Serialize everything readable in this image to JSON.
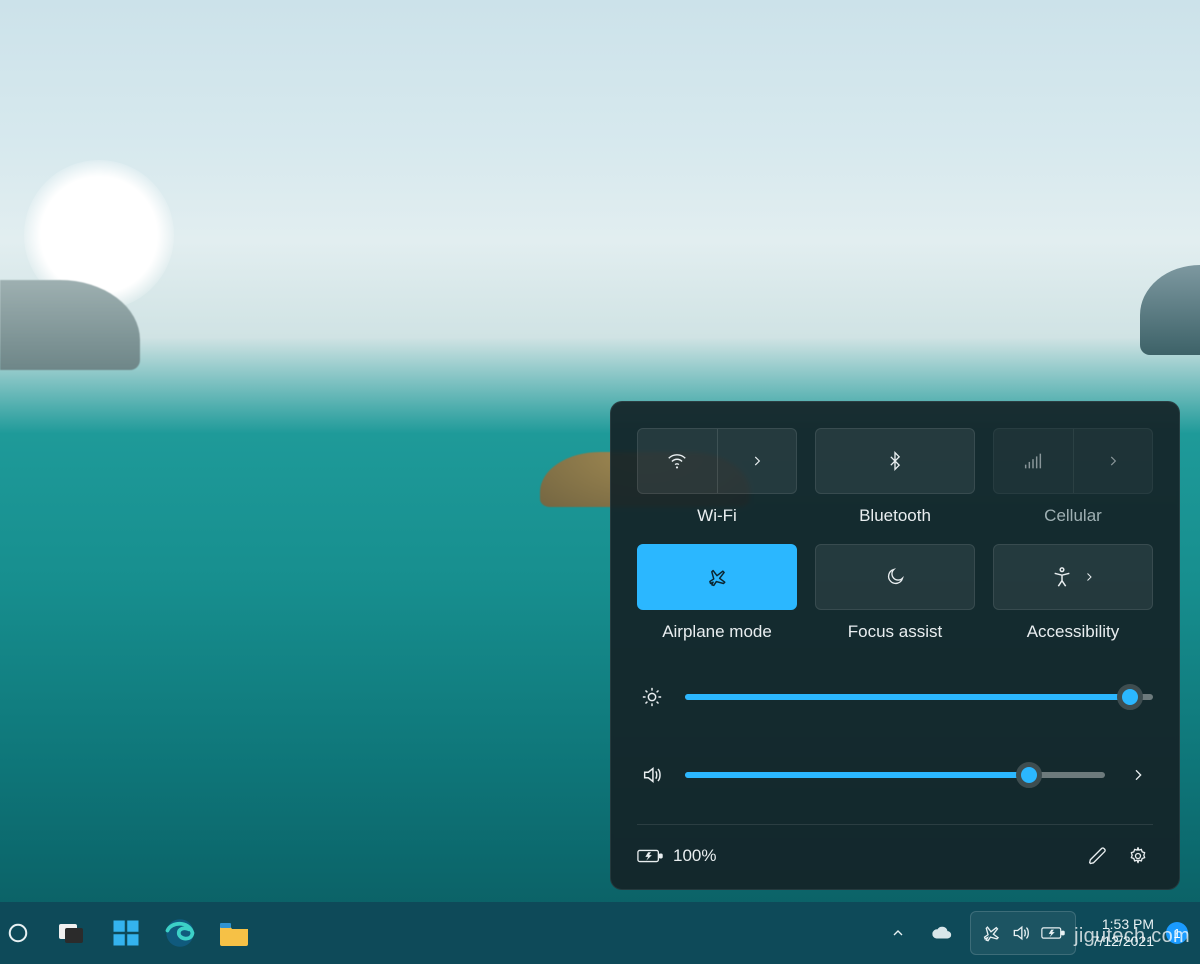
{
  "quick_settings": {
    "tiles": [
      {
        "id": "wifi",
        "label": "Wi-Fi",
        "active": false,
        "split": true,
        "dim": false,
        "icon": "wifi-icon"
      },
      {
        "id": "bluetooth",
        "label": "Bluetooth",
        "active": false,
        "split": false,
        "dim": false,
        "icon": "bluetooth-icon"
      },
      {
        "id": "cellular",
        "label": "Cellular",
        "active": false,
        "split": true,
        "dim": true,
        "icon": "signal-icon"
      },
      {
        "id": "airplane",
        "label": "Airplane mode",
        "active": true,
        "split": false,
        "dim": false,
        "icon": "airplane-icon"
      },
      {
        "id": "focus",
        "label": "Focus assist",
        "active": false,
        "split": false,
        "dim": false,
        "icon": "moon-icon"
      },
      {
        "id": "access",
        "label": "Accessibility",
        "active": false,
        "split": false,
        "dim": false,
        "icon": "accessibility-icon",
        "chevron": true
      }
    ],
    "brightness_pct": 95,
    "volume_pct": 82,
    "battery_text": "100%"
  },
  "taskbar": {
    "time": "1:53 PM",
    "date": "7/12/2021",
    "notif_count": "1"
  },
  "watermark": "jigutech.com"
}
